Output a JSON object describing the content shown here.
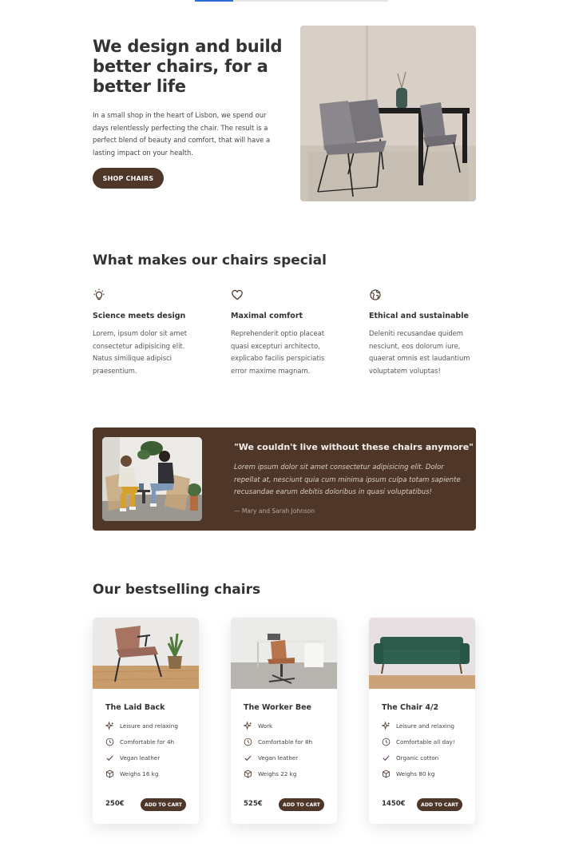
{
  "hero": {
    "title": "We design and build better chairs, for a better life",
    "text": "In a small shop in the heart of Lisbon, we spend our days relentlessly perfecting the chair. The result is a perfect blend of beauty and comfort, that will have a lasting impact on your health.",
    "cta": "SHOP CHAIRS"
  },
  "features": {
    "title": "What makes our chairs special",
    "items": [
      {
        "icon": "lightbulb-icon",
        "title": "Science meets design",
        "text": "Lorem, ipsum dolor sit amet consectetur adipisicing elit. Natus similique adipisci praesentium."
      },
      {
        "icon": "heart-icon",
        "title": "Maximal comfort",
        "text": "Reprehenderit optio placeat quasi excepturi architecto, explicabo facilis perspiciatis error maxime magnam."
      },
      {
        "icon": "globe-icon",
        "title": "Ethical and sustainable",
        "text": "Deleniti recusandae quidem nesciunt, eos dolorum iure, quaerat omnis est laudantium voluptatem voluptas!"
      }
    ]
  },
  "testimonial": {
    "quote": "\"We couldn't live without these chairs anymore\"",
    "body": "Lorem ipsum dolor sit amet consectetur adipisicing elit. Dolor repellat at, nesciunt quia cum minima ipsum culpa totam sapiente recusandae earum debitis doloribus in quasi voluptatibus!",
    "author": "— Mary and Sarah Johnson"
  },
  "bestsellers": {
    "title": "Our bestselling chairs",
    "cart_label": "ADD TO CART",
    "products": [
      {
        "name": "The Laid Back",
        "features": [
          "Leisure and relaxing",
          "Comfortable for 4h",
          "Vegan leather",
          "Weighs 16 kg"
        ],
        "price": "250€"
      },
      {
        "name": "The Worker Bee",
        "features": [
          "Work",
          "Comfortable for 8h",
          "Vegan leather",
          "Weighs 22 kg"
        ],
        "price": "525€"
      },
      {
        "name": "The Chair 4/2",
        "features": [
          "Leisure and relaxing",
          "Comfortable all day!",
          "Organic cotton",
          "Weighs 80 kg"
        ],
        "price": "1450€"
      }
    ],
    "feature_icons": [
      "sparkles-icon",
      "clock-icon",
      "check-icon",
      "box-icon"
    ]
  },
  "colors": {
    "brand": "#4e3629",
    "text": "#333333",
    "accent_line": "#2a6fd6"
  }
}
